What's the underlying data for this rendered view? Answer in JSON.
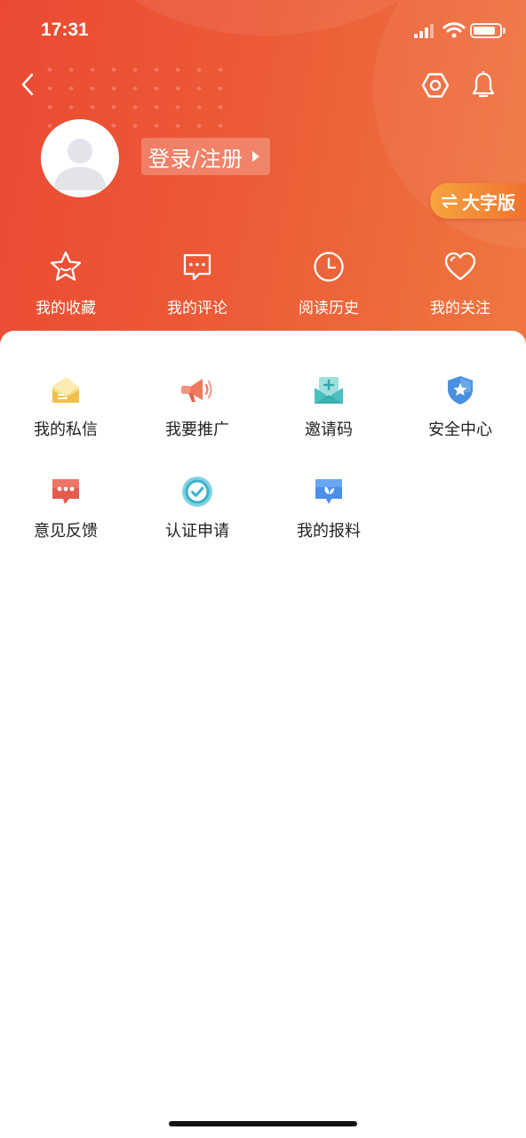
{
  "status_bar": {
    "time": "17:31"
  },
  "profile": {
    "login_label": "登录/注册",
    "bigfont_label": "大字版"
  },
  "quick_actions": [
    {
      "label": "我的收藏",
      "icon": "star-icon"
    },
    {
      "label": "我的评论",
      "icon": "comment-icon"
    },
    {
      "label": "阅读历史",
      "icon": "clock-icon"
    },
    {
      "label": "我的关注",
      "icon": "heart-icon"
    }
  ],
  "services": [
    {
      "label": "我的私信",
      "icon": "envelope-icon",
      "color": "#f1c84e"
    },
    {
      "label": "我要推广",
      "icon": "megaphone-icon",
      "color": "#f07a5f"
    },
    {
      "label": "邀请码",
      "icon": "invite-icon",
      "color": "#4cc0c0"
    },
    {
      "label": "安全中心",
      "icon": "shield-icon",
      "color": "#4a90e2"
    },
    {
      "label": "意见反馈",
      "icon": "feedback-icon",
      "color": "#e45a4c"
    },
    {
      "label": "认证申请",
      "icon": "verified-icon",
      "color": "#3bb0c9"
    },
    {
      "label": "我的报料",
      "icon": "report-icon",
      "color": "#4a8fe8"
    }
  ],
  "colors": {
    "header_start": "#ea4a33",
    "header_end": "#ef7741",
    "accent_orange": "#f0712e"
  }
}
